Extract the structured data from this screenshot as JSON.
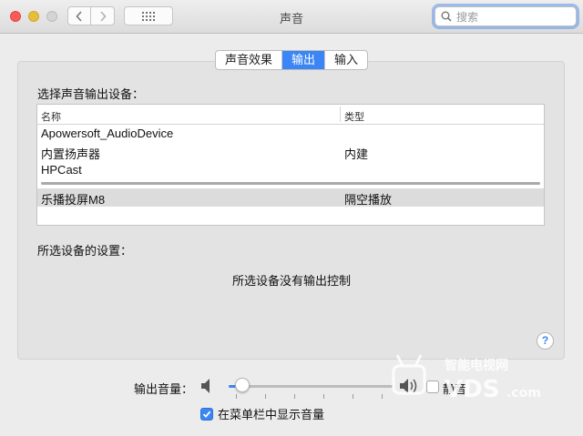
{
  "window": {
    "title": "声音"
  },
  "search": {
    "placeholder": "搜索"
  },
  "tabs": [
    {
      "label": "声音效果",
      "active": false
    },
    {
      "label": "输出",
      "active": true
    },
    {
      "label": "输入",
      "active": false
    }
  ],
  "output": {
    "section_label": "选择声音输出设备：",
    "columns": {
      "name": "名称",
      "type": "类型"
    },
    "devices": [
      {
        "name": "Apowersoft_AudioDevice",
        "type": ""
      },
      {
        "name": "内置扬声器",
        "type": "内建"
      },
      {
        "name": "HPCast",
        "type": ""
      },
      {
        "name": "乐播投屏M8",
        "type": "隔空播放",
        "selected": true
      }
    ],
    "settings_label": "所选设备的设置：",
    "no_controls_message": "所选设备没有输出控制"
  },
  "volume": {
    "label": "输出音量：",
    "level": 0.04,
    "mute_label": "静音",
    "mute_checked": false,
    "show_in_menubar_label": "在菜单栏中显示音量",
    "show_in_menubar_checked": true
  },
  "help": {
    "label": "?"
  },
  "watermark": {
    "text1": "智能电视网",
    "text2": "VDS",
    "text3": ".com"
  },
  "colors": {
    "accent": "#3b86f4",
    "close": "#fc5b57",
    "minimize": "#e5bf3c"
  }
}
